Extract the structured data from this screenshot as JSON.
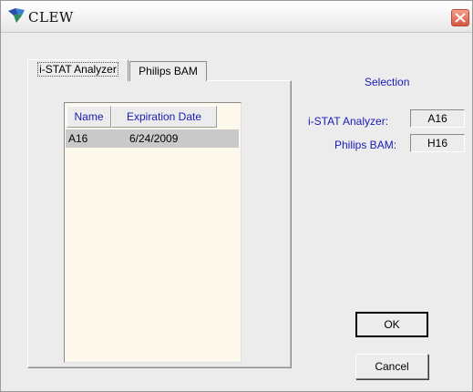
{
  "window": {
    "title": "CLEW",
    "close_icon": "close-icon"
  },
  "tabs": [
    {
      "label": "i-STAT Analyzer",
      "active": true
    },
    {
      "label": "Philips BAM",
      "active": false
    }
  ],
  "list": {
    "columns": [
      "Name",
      "Expiration Date"
    ],
    "rows": [
      {
        "name": "A16",
        "expiration_date": "6/24/2009",
        "selected": true
      }
    ]
  },
  "selection": {
    "heading": "Selection",
    "istat_label": "i-STAT Analyzer:",
    "istat_value": "A16",
    "philips_label": "Philips BAM:",
    "philips_value": "H16"
  },
  "buttons": {
    "ok": "OK",
    "cancel": "Cancel"
  },
  "colors": {
    "label_blue": "#1a1ab8",
    "list_background": "#fdf8ec",
    "selected_row": "#c9c9c9"
  }
}
